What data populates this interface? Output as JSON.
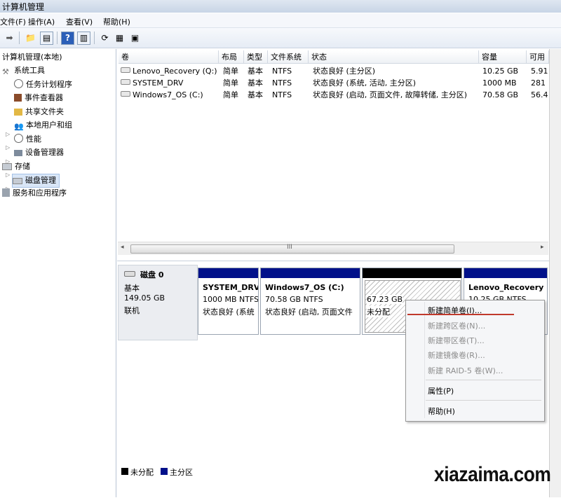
{
  "window": {
    "title": "计算机管理"
  },
  "menu": {
    "items": [
      "文件(F)",
      "操作(A)",
      "查看(V)",
      "帮助(H)"
    ]
  },
  "tree": {
    "root": "计算机管理(本地)",
    "system_tools": "系统工具",
    "task_scheduler": "任务计划程序",
    "event_viewer": "事件查看器",
    "shared_folders": "共享文件夹",
    "local_users": "本地用户和组",
    "performance": "性能",
    "device_manager": "设备管理器",
    "storage": "存储",
    "disk_management": "磁盘管理",
    "services_apps": "服务和应用程序"
  },
  "table": {
    "headers": [
      "卷",
      "布局",
      "类型",
      "文件系统",
      "状态",
      "容量",
      "可用"
    ],
    "rows": [
      [
        "Lenovo_Recovery (Q:)",
        "简单",
        "基本",
        "NTFS",
        "状态良好 (主分区)",
        "10.25 GB",
        "5.91"
      ],
      [
        "SYSTEM_DRV",
        "简单",
        "基本",
        "NTFS",
        "状态良好 (系统, 活动, 主分区)",
        "1000 MB",
        "281"
      ],
      [
        "Windows7_OS (C:)",
        "简单",
        "基本",
        "NTFS",
        "状态良好 (启动, 页面文件, 故障转储, 主分区)",
        "70.58 GB",
        "56.4"
      ]
    ],
    "scroll_grip": "III"
  },
  "disk": {
    "name": "磁盘 0",
    "type": "基本",
    "size": "149.05 GB",
    "status": "联机",
    "partitions": [
      {
        "name": "SYSTEM_DRV",
        "size_fs": "1000 MB NTFS",
        "status": "状态良好 (系统"
      },
      {
        "name": "Windows7_OS  (C:)",
        "size_fs": "70.58 GB NTFS",
        "status": "状态良好 (启动, 页面文件"
      },
      {
        "name": "",
        "size_fs": "67.23 GB",
        "status": "未分配"
      },
      {
        "name": "Lenovo_Recovery",
        "size_fs": "10.25 GB NTFS",
        "status": ""
      }
    ]
  },
  "context_menu": {
    "items": [
      {
        "label": "新建简单卷(I)...",
        "enabled": true
      },
      {
        "label": "新建跨区卷(N)...",
        "enabled": false
      },
      {
        "label": "新建带区卷(T)...",
        "enabled": false
      },
      {
        "label": "新建镜像卷(R)...",
        "enabled": false
      },
      {
        "label": "新建 RAID-5 卷(W)...",
        "enabled": false
      },
      {
        "label": "属性(P)",
        "enabled": true
      },
      {
        "label": "帮助(H)",
        "enabled": true
      }
    ]
  },
  "legend": {
    "unallocated": "未分配",
    "primary": "主分区"
  },
  "colors": {
    "primary_bar": "#00108a",
    "unallocated_bar": "#000000",
    "annotation_red": "#c0392b"
  },
  "watermark": {
    "text": "xiazaima.com"
  }
}
